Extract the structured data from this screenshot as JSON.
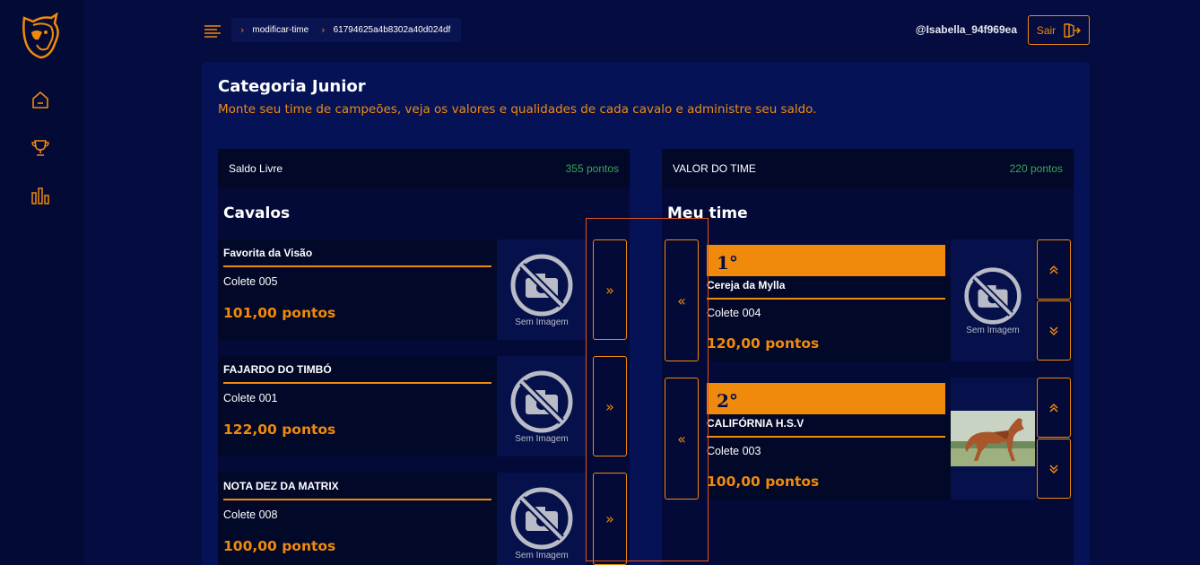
{
  "brand": {
    "accent": "#f08a0c",
    "bg": "#040c40",
    "success": "#3aa55a"
  },
  "sidebar": {
    "logo_icon": "horse-head-logo",
    "items": [
      {
        "icon": "home-icon"
      },
      {
        "icon": "trophy-icon"
      },
      {
        "icon": "bar-chart-icon"
      }
    ]
  },
  "topbar": {
    "menu_icon": "menu-icon",
    "breadcrumb": [
      "modificar-time",
      "61794625a4b8302a40d024df"
    ],
    "username": "@Isabella_94f969ea",
    "logout_label": "Sair"
  },
  "page": {
    "title": "Categoria Junior",
    "subtitle": "Monte seu time de campeões, veja os valores e qualidades de cada cavalo e administre seu saldo."
  },
  "left_panel": {
    "header_label": "Saldo Livre",
    "header_value": "355 pontos",
    "title": "Cavalos",
    "horses": [
      {
        "name": "Favorita da Visão",
        "colete": "Colete 005",
        "points": "101,00 pontos",
        "image": "Sem Imagem"
      },
      {
        "name": "FAJARDO DO TIMBÓ",
        "colete": "Colete 001",
        "points": "122,00 pontos",
        "image": "Sem Imagem"
      },
      {
        "name": "NOTA DEZ DA MATRIX",
        "colete": "Colete 008",
        "points": "100,00 pontos",
        "image": "Sem Imagem"
      }
    ],
    "add_label": "»"
  },
  "right_panel": {
    "header_label": "VALOR DO TIME",
    "header_value": "220 pontos",
    "title": "Meu time",
    "team": [
      {
        "rank": "1°",
        "name": "Cereja da Mylla",
        "colete": "Colete 004",
        "points": "120,00 pontos",
        "image": "Sem Imagem"
      },
      {
        "rank": "2°",
        "name": "CALIFÓRNIA H.S.V",
        "colete": "Colete 003",
        "points": "100,00 pontos",
        "image": "horse-photo"
      }
    ],
    "remove_label": "«"
  }
}
